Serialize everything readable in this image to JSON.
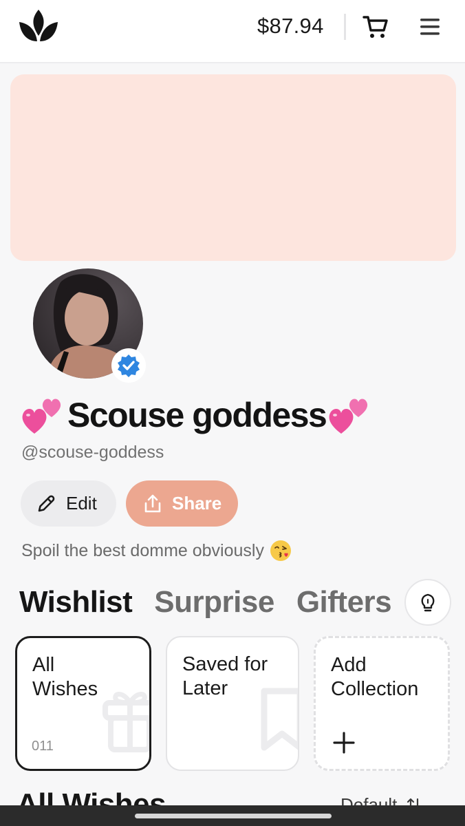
{
  "header": {
    "balance": "$87.94",
    "logo_icon": "crown-lotus-logo",
    "cart_icon": "cart-icon",
    "menu_icon": "hamburger-menu-icon"
  },
  "profile": {
    "display_name": "Scouse goddess",
    "name_decoration": "two-hearts-emoji",
    "handle": "@scouse-goddess",
    "verified": true,
    "bio": "Spoil the best domme obviously",
    "bio_emoji": "kissing-face-emoji"
  },
  "actions": {
    "edit_label": "Edit",
    "share_label": "Share"
  },
  "tabs": [
    {
      "label": "Wishlist",
      "active": true
    },
    {
      "label": "Surprise",
      "active": false
    },
    {
      "label": "Gifters",
      "active": false
    }
  ],
  "collections": [
    {
      "title_line1": "All",
      "title_line2": "Wishes",
      "count": "011",
      "selected": true,
      "icon": "gift-icon"
    },
    {
      "title_line1": "Saved for",
      "title_line2": "Later",
      "selected": false,
      "icon": "bookmark-icon"
    },
    {
      "title_line1": "Add",
      "title_line2": "Collection",
      "selected": false,
      "icon": "plus-icon"
    }
  ],
  "section": {
    "title": "All Wishes",
    "sort_label": "Default"
  },
  "colors": {
    "banner": "#fde5de",
    "share_button": "#eca790",
    "verified_badge": "#2f86e0"
  }
}
